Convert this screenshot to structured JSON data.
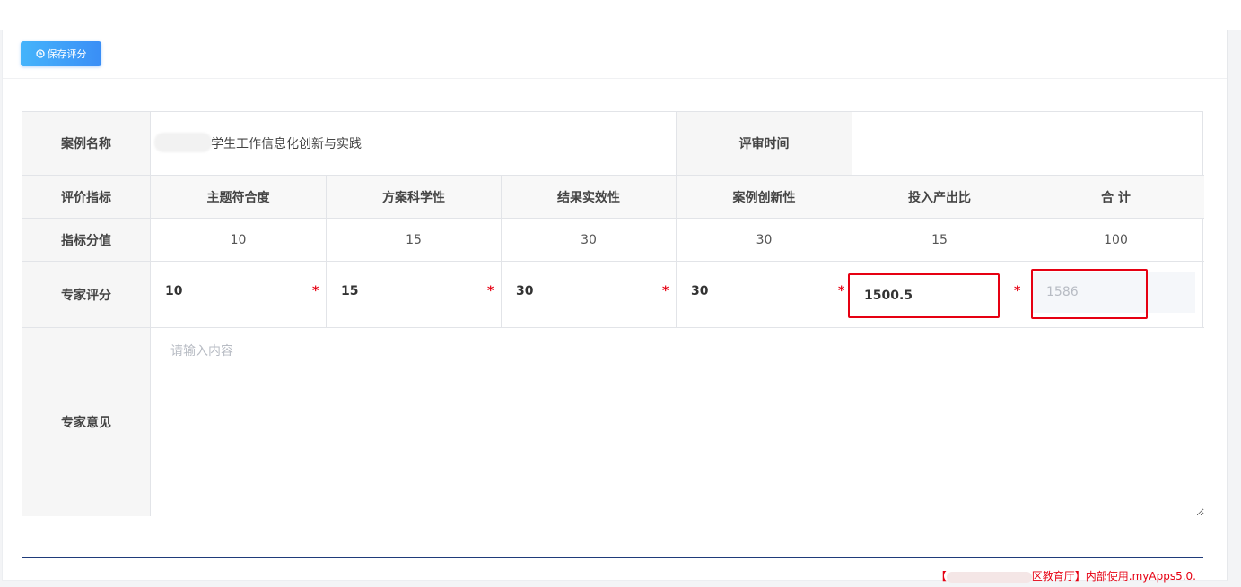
{
  "toolbar": {
    "save_label": "保存评分",
    "save_icon": "clock-icon"
  },
  "table": {
    "case_name_label": "案例名称",
    "case_name_value": "学生工作信息化创新与实践",
    "review_time_label": "评审时间",
    "review_time_value": "",
    "criteria_label": "评价指标",
    "criteria": [
      "主题符合度",
      "方案科学性",
      "结果实效性",
      "案例创新性",
      "投入产出比"
    ],
    "total_label": "合 计",
    "points_label": "指标分值",
    "points": [
      "10",
      "15",
      "30",
      "30",
      "15"
    ],
    "points_total": "100",
    "expert_score_label": "专家评分",
    "scores": [
      "10",
      "15",
      "30",
      "30",
      "1500.5"
    ],
    "score_total": "1586",
    "required_mark": "*",
    "opinion_label": "专家意见",
    "opinion_placeholder": "请输入内容"
  },
  "footer": {
    "left_bracket": "【",
    "org_suffix": "区教育厅】内部使用.myApps5.0."
  },
  "colors": {
    "accent": "#3a8ef6",
    "error": "#e60012",
    "footer_line": "#1f3b7a"
  }
}
